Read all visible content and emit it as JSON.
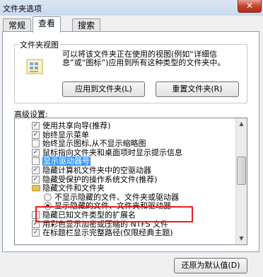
{
  "window": {
    "title": "文件夹选项",
    "close_glyph": "✕"
  },
  "tabs": [
    {
      "label": "常规"
    },
    {
      "label": "查看"
    },
    {
      "label": "搜索"
    }
  ],
  "folder_views": {
    "legend": "文件夹视图",
    "description": "可以将该文件夹正在使用的视图(例如“详细信息”或“图标”)应用到所有这种类型的文件夹中。",
    "apply_button": "应用到文件夹(L)",
    "reset_button": "重置文件夹(R)"
  },
  "advanced": {
    "label": "高级设置:",
    "items": [
      {
        "type": "checkbox",
        "checked": true,
        "indent": 0,
        "label": "使用共享向导(推荐)"
      },
      {
        "type": "checkbox",
        "checked": true,
        "indent": 0,
        "label": "始终显示菜单"
      },
      {
        "type": "checkbox",
        "checked": false,
        "indent": 0,
        "label": "始终显示图标,从不显示缩略图"
      },
      {
        "type": "checkbox",
        "checked": true,
        "indent": 0,
        "label": "鼠标指向文件夹和桌面项时显示提示信息"
      },
      {
        "type": "checkbox",
        "checked": false,
        "indent": 0,
        "label": "显示驱动器号",
        "selected": true
      },
      {
        "type": "checkbox",
        "checked": true,
        "indent": 0,
        "label": "隐藏计算机文件夹中的空驱动器"
      },
      {
        "type": "checkbox",
        "checked": true,
        "indent": 0,
        "label": "隐藏受保护的操作系统文件(推荐)"
      },
      {
        "type": "folder",
        "indent": 0,
        "label": "隐藏文件和文件夹"
      },
      {
        "type": "radio",
        "checked": false,
        "indent": 1,
        "label": "不显示隐藏的文件、文件夹或驱动器"
      },
      {
        "type": "radio",
        "checked": true,
        "indent": 1,
        "label": "显示隐藏的文件、文件夹和驱动器"
      },
      {
        "type": "checkbox",
        "checked": false,
        "indent": 0,
        "label": "隐藏已知文件类型的扩展名"
      },
      {
        "type": "checkbox",
        "checked": true,
        "indent": 0,
        "label": "用彩色显示加密或压缩的 NTFS 文件"
      },
      {
        "type": "checkbox",
        "checked": true,
        "indent": 0,
        "label": "在标题栏显示完整路径(仅限经典主题)"
      }
    ]
  },
  "restore_button": "还原为默认值(D)"
}
